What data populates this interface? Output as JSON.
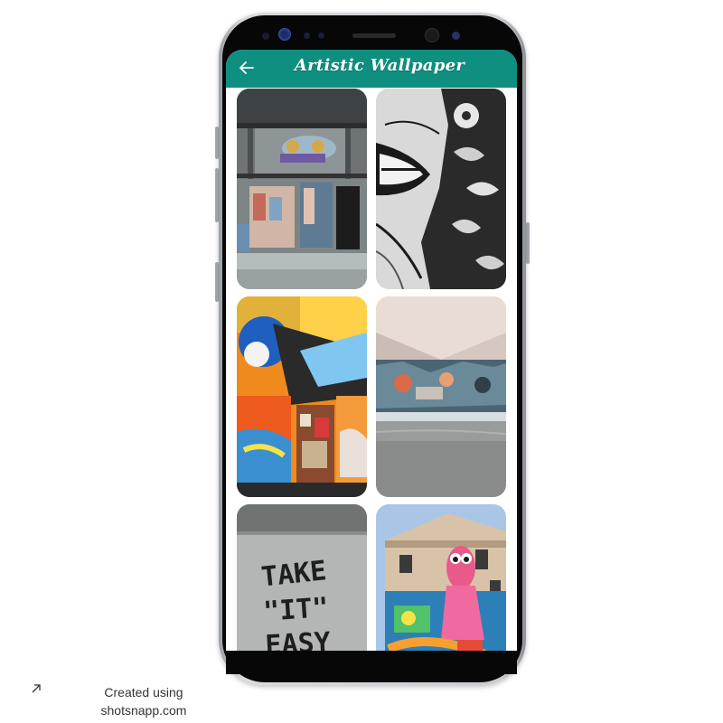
{
  "app": {
    "title": "Artistic Wallpaper",
    "accent_color": "#0e8f80",
    "back_icon": "arrow-left-icon"
  },
  "wallpapers": [
    {
      "id": 1,
      "subject": "graffiti-covered industrial building doorway"
    },
    {
      "id": 2,
      "subject": "black and white mural with open mouth and flowers"
    },
    {
      "id": 3,
      "subject": "colorful abstract graffiti wall with stickered door"
    },
    {
      "id": 4,
      "subject": "graffiti wall under concrete overpass"
    },
    {
      "id": 5,
      "subject": "concrete wall with handwritten words"
    },
    {
      "id": 6,
      "subject": "colorful cartoon mural on building facade"
    }
  ],
  "tile5_text": {
    "line1": "TAKE",
    "line2": "\"IT\"",
    "line3": "EASY"
  },
  "footer": {
    "line1": "Created using",
    "line2": "shotsnapp.com",
    "icon": "external-link-arrow-icon"
  }
}
